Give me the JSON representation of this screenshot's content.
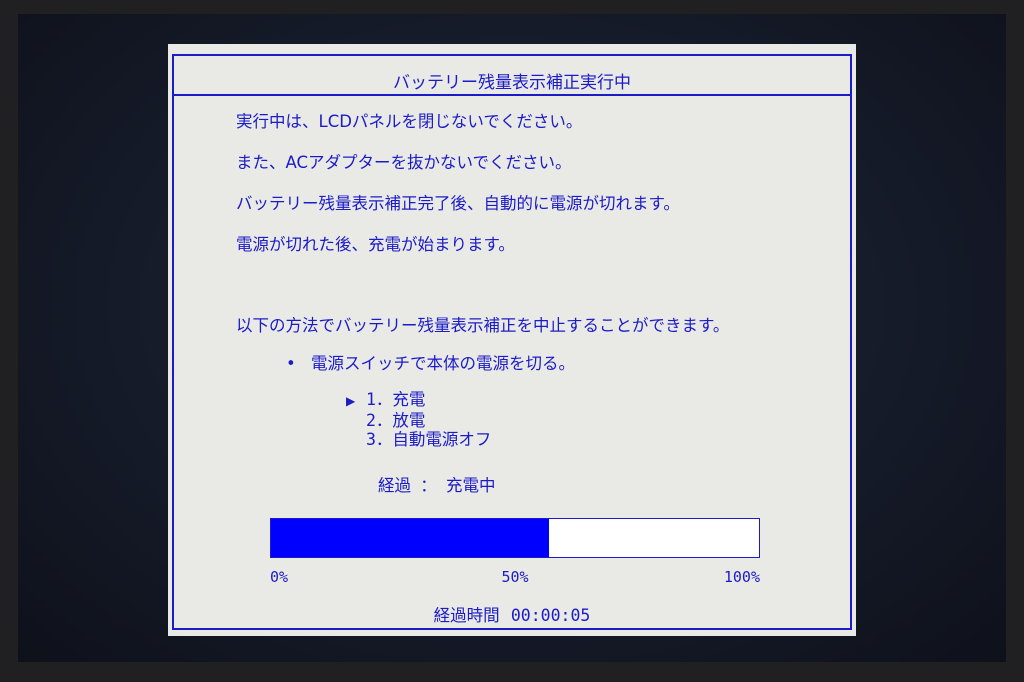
{
  "dialog": {
    "title": "バッテリー残量表示補正実行中",
    "messages": [
      "実行中は、LCDパネルを閉じないでください。",
      "また、ACアダプターを抜かないでください。",
      "バッテリー残量表示補正完了後、自動的に電源が切れます。",
      "電源が切れた後、充電が始まります。"
    ],
    "cancel_intro": "以下の方法でバッテリー残量表示補正を中止することができます。",
    "bullet_glyph": "•",
    "cancel_method": "電源スイッチで本体の電源を切る。",
    "steps": [
      {
        "marker": "▶",
        "label": "1．充電",
        "active": true
      },
      {
        "marker": "",
        "label": "2．放電",
        "active": false
      },
      {
        "marker": "",
        "label": "3．自動電源オフ",
        "active": false
      }
    ],
    "status_label": "経過",
    "status_sep": "：",
    "status_value": "充電中",
    "progress": {
      "fraction": 0.57,
      "fill_color": "#0000ff",
      "ticks": [
        "0%",
        "50%",
        "100%"
      ]
    },
    "elapsed_label": "経過時間",
    "elapsed_value": "00:00:05"
  },
  "colors": {
    "text": "#1b1bc8",
    "panel": "#e9e9e6",
    "screen": "#151a28"
  }
}
